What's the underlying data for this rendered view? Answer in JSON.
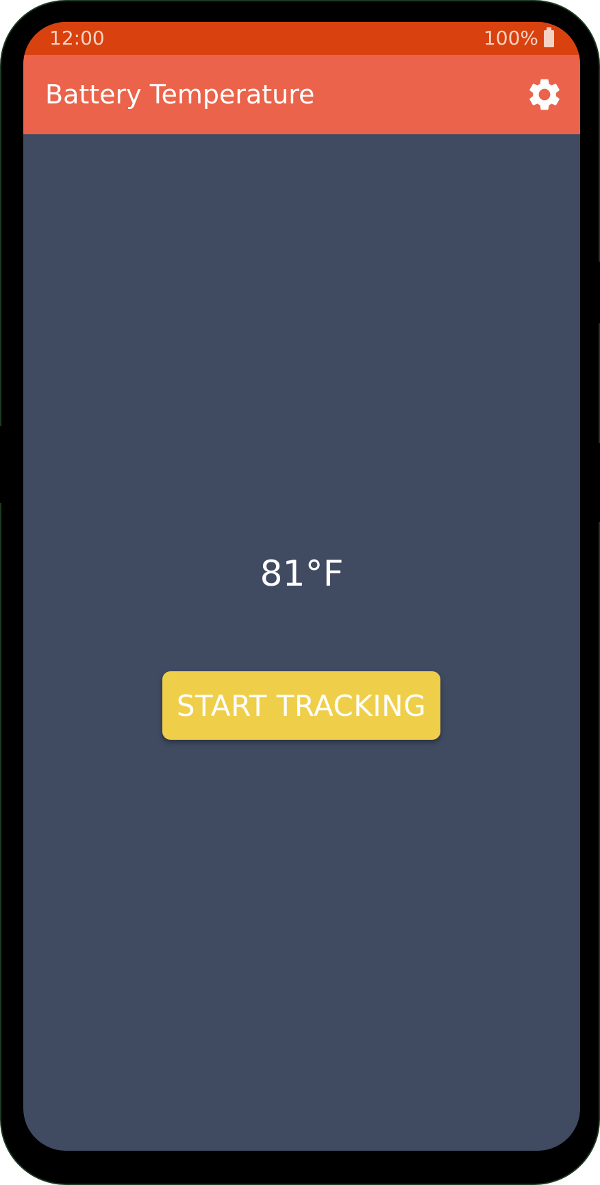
{
  "status_bar": {
    "time": "12:00",
    "battery_percent": "100%",
    "battery_icon": "battery-full-icon",
    "color": "#d9420e"
  },
  "app_bar": {
    "title": "Battery Temperature",
    "settings_icon": "gear-icon",
    "color": "#eb634a"
  },
  "main": {
    "temperature": "81°F",
    "start_button_label": "START TRACKING",
    "background_color": "#404b62",
    "button_color": "#efcf4a"
  }
}
